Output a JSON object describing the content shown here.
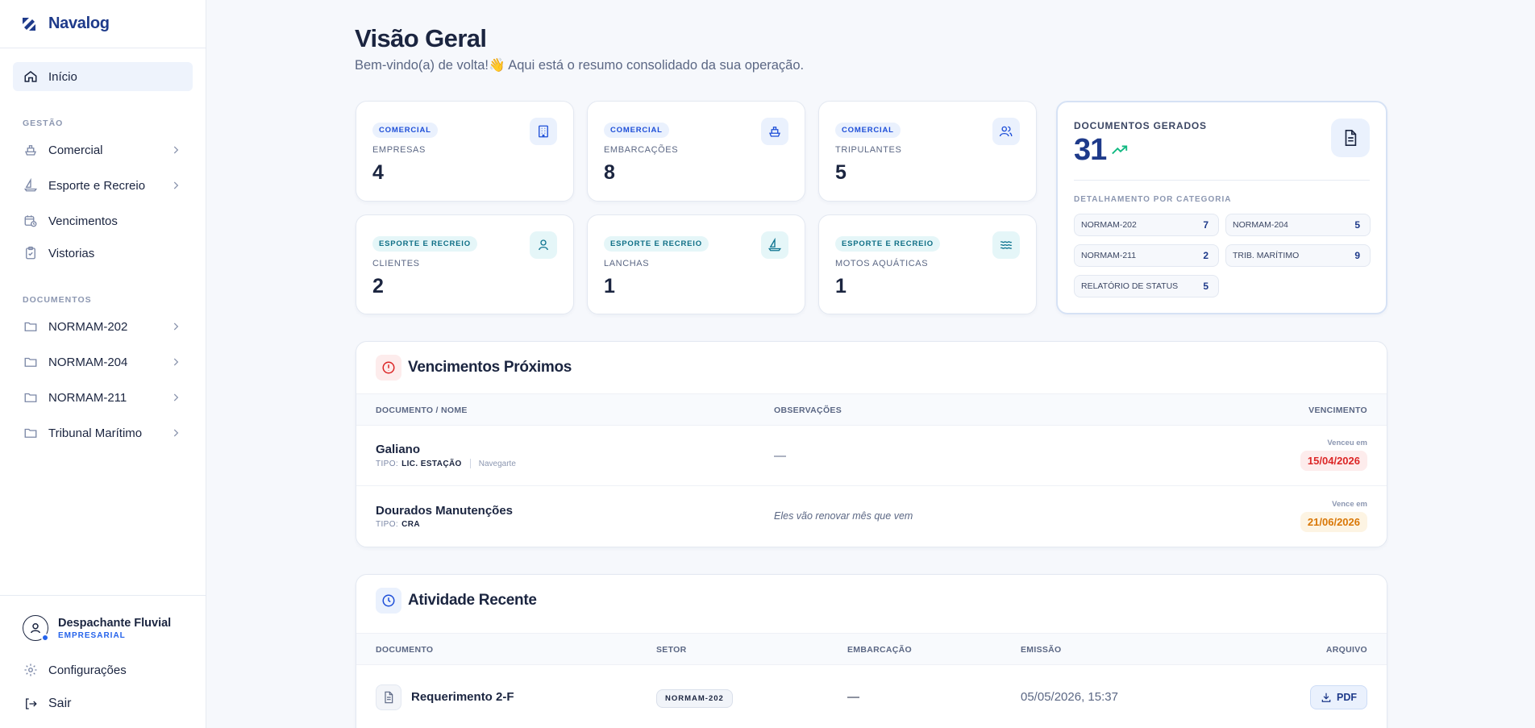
{
  "brand": {
    "name": "Navalog"
  },
  "nav": {
    "inicio": "Início",
    "gestao_section": "GESTÃO",
    "comercial": "Comercial",
    "esporte": "Esporte e Recreio",
    "vencimentos": "Vencimentos",
    "vistorias": "Vistorias",
    "documentos_section": "DOCUMENTOS",
    "normam202": "NORMAM-202",
    "normam204": "NORMAM-204",
    "normam211": "NORMAM-211",
    "tribunal": "Tribunal Marítimo"
  },
  "user": {
    "name": "Despachante Fluvial",
    "role": "EMPRESARIAL"
  },
  "bottom": {
    "config": "Configurações",
    "sair": "Sair"
  },
  "header": {
    "title": "Visão Geral",
    "subtitle": "Bem-vindo(a) de volta!👋 Aqui está o resumo consolidado da sua operação."
  },
  "stats": [
    {
      "badge": "COMERCIAL",
      "label": "EMPRESAS",
      "value": "4",
      "icon": "building-icon"
    },
    {
      "badge": "COMERCIAL",
      "label": "EMBARCAÇÕES",
      "value": "8",
      "icon": "ship-icon"
    },
    {
      "badge": "COMERCIAL",
      "label": "TRIPULANTES",
      "value": "5",
      "icon": "users-icon"
    },
    {
      "badge": "ESPORTE E RECREIO",
      "label": "CLIENTES",
      "value": "2",
      "icon": "user-icon"
    },
    {
      "badge": "ESPORTE E RECREIO",
      "label": "LANCHAS",
      "value": "1",
      "icon": "sailboat-icon"
    },
    {
      "badge": "ESPORTE E RECREIO",
      "label": "MOTOS AQUÁTICAS",
      "value": "1",
      "icon": "waves-icon"
    }
  ],
  "docs": {
    "title": "DOCUMENTOS GERADOS",
    "total": "31",
    "breakdown_title": "DETALHAMENTO POR CATEGORIA",
    "categories": [
      {
        "name": "NORMAM-202",
        "value": "7"
      },
      {
        "name": "NORMAM-204",
        "value": "5"
      },
      {
        "name": "NORMAM-211",
        "value": "2"
      },
      {
        "name": "TRIB. MARÍTIMO",
        "value": "9"
      },
      {
        "name": "RELATÓRIO DE STATUS",
        "value": "5"
      }
    ]
  },
  "vencimentos": {
    "title": "Vencimentos Próximos",
    "columns": {
      "doc": "DOCUMENTO / NOME",
      "obs": "OBSERVAÇÕES",
      "venc": "VENCIMENTO"
    },
    "rows": [
      {
        "name": "Galiano",
        "type_label": "TIPO:",
        "type": "LIC. ESTAÇÃO",
        "tag": "Navegarte",
        "obs": "—",
        "due_label": "Venceu em",
        "due": "15/04/2026"
      },
      {
        "name": "Dourados Manutenções",
        "type_label": "TIPO:",
        "type": "CRA",
        "obs": "Eles vão renovar mês que vem",
        "due_label": "Vence em",
        "due": "21/06/2026"
      }
    ]
  },
  "atividade": {
    "title": "Atividade Recente",
    "columns": {
      "doc": "DOCUMENTO",
      "setor": "SETOR",
      "emb": "EMBARCAÇÃO",
      "emi": "EMISSÃO",
      "arq": "ARQUIVO"
    },
    "rows": [
      {
        "doc": "Requerimento 2-F",
        "setor": "NORMAM-202",
        "emb": "—",
        "emi": "05/05/2026, 15:37",
        "arq": "PDF"
      }
    ]
  },
  "colors": {
    "accent": "#1e3a8a",
    "overdue": "#dc2626",
    "soon": "#d97706",
    "comercial": "#1d4ed8",
    "esporte": "#0e7490"
  }
}
